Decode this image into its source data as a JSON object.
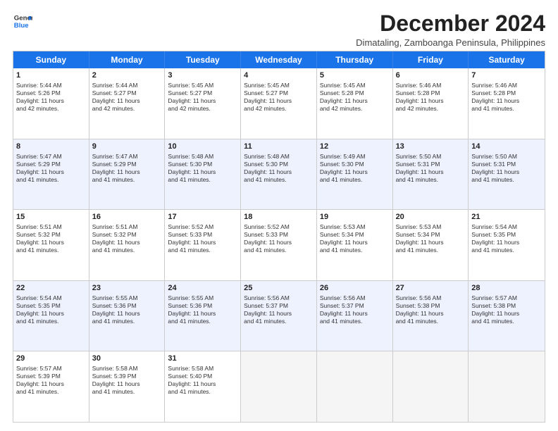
{
  "logo": {
    "line1": "General",
    "line2": "Blue"
  },
  "title": "December 2024",
  "location": "Dimataling, Zamboanga Peninsula, Philippines",
  "header": {
    "days": [
      "Sunday",
      "Monday",
      "Tuesday",
      "Wednesday",
      "Thursday",
      "Friday",
      "Saturday"
    ]
  },
  "rows": [
    [
      {
        "day": "1",
        "sunrise": "Sunrise: 5:44 AM",
        "sunset": "Sunset: 5:26 PM",
        "daylight": "Daylight: 11 hours",
        "minutes": "and 42 minutes."
      },
      {
        "day": "2",
        "sunrise": "Sunrise: 5:44 AM",
        "sunset": "Sunset: 5:27 PM",
        "daylight": "Daylight: 11 hours",
        "minutes": "and 42 minutes."
      },
      {
        "day": "3",
        "sunrise": "Sunrise: 5:45 AM",
        "sunset": "Sunset: 5:27 PM",
        "daylight": "Daylight: 11 hours",
        "minutes": "and 42 minutes."
      },
      {
        "day": "4",
        "sunrise": "Sunrise: 5:45 AM",
        "sunset": "Sunset: 5:27 PM",
        "daylight": "Daylight: 11 hours",
        "minutes": "and 42 minutes."
      },
      {
        "day": "5",
        "sunrise": "Sunrise: 5:45 AM",
        "sunset": "Sunset: 5:28 PM",
        "daylight": "Daylight: 11 hours",
        "minutes": "and 42 minutes."
      },
      {
        "day": "6",
        "sunrise": "Sunrise: 5:46 AM",
        "sunset": "Sunset: 5:28 PM",
        "daylight": "Daylight: 11 hours",
        "minutes": "and 42 minutes."
      },
      {
        "day": "7",
        "sunrise": "Sunrise: 5:46 AM",
        "sunset": "Sunset: 5:28 PM",
        "daylight": "Daylight: 11 hours",
        "minutes": "and 41 minutes."
      }
    ],
    [
      {
        "day": "8",
        "sunrise": "Sunrise: 5:47 AM",
        "sunset": "Sunset: 5:29 PM",
        "daylight": "Daylight: 11 hours",
        "minutes": "and 41 minutes."
      },
      {
        "day": "9",
        "sunrise": "Sunrise: 5:47 AM",
        "sunset": "Sunset: 5:29 PM",
        "daylight": "Daylight: 11 hours",
        "minutes": "and 41 minutes."
      },
      {
        "day": "10",
        "sunrise": "Sunrise: 5:48 AM",
        "sunset": "Sunset: 5:30 PM",
        "daylight": "Daylight: 11 hours",
        "minutes": "and 41 minutes."
      },
      {
        "day": "11",
        "sunrise": "Sunrise: 5:48 AM",
        "sunset": "Sunset: 5:30 PM",
        "daylight": "Daylight: 11 hours",
        "minutes": "and 41 minutes."
      },
      {
        "day": "12",
        "sunrise": "Sunrise: 5:49 AM",
        "sunset": "Sunset: 5:30 PM",
        "daylight": "Daylight: 11 hours",
        "minutes": "and 41 minutes."
      },
      {
        "day": "13",
        "sunrise": "Sunrise: 5:50 AM",
        "sunset": "Sunset: 5:31 PM",
        "daylight": "Daylight: 11 hours",
        "minutes": "and 41 minutes."
      },
      {
        "day": "14",
        "sunrise": "Sunrise: 5:50 AM",
        "sunset": "Sunset: 5:31 PM",
        "daylight": "Daylight: 11 hours",
        "minutes": "and 41 minutes."
      }
    ],
    [
      {
        "day": "15",
        "sunrise": "Sunrise: 5:51 AM",
        "sunset": "Sunset: 5:32 PM",
        "daylight": "Daylight: 11 hours",
        "minutes": "and 41 minutes."
      },
      {
        "day": "16",
        "sunrise": "Sunrise: 5:51 AM",
        "sunset": "Sunset: 5:32 PM",
        "daylight": "Daylight: 11 hours",
        "minutes": "and 41 minutes."
      },
      {
        "day": "17",
        "sunrise": "Sunrise: 5:52 AM",
        "sunset": "Sunset: 5:33 PM",
        "daylight": "Daylight: 11 hours",
        "minutes": "and 41 minutes."
      },
      {
        "day": "18",
        "sunrise": "Sunrise: 5:52 AM",
        "sunset": "Sunset: 5:33 PM",
        "daylight": "Daylight: 11 hours",
        "minutes": "and 41 minutes."
      },
      {
        "day": "19",
        "sunrise": "Sunrise: 5:53 AM",
        "sunset": "Sunset: 5:34 PM",
        "daylight": "Daylight: 11 hours",
        "minutes": "and 41 minutes."
      },
      {
        "day": "20",
        "sunrise": "Sunrise: 5:53 AM",
        "sunset": "Sunset: 5:34 PM",
        "daylight": "Daylight: 11 hours",
        "minutes": "and 41 minutes."
      },
      {
        "day": "21",
        "sunrise": "Sunrise: 5:54 AM",
        "sunset": "Sunset: 5:35 PM",
        "daylight": "Daylight: 11 hours",
        "minutes": "and 41 minutes."
      }
    ],
    [
      {
        "day": "22",
        "sunrise": "Sunrise: 5:54 AM",
        "sunset": "Sunset: 5:35 PM",
        "daylight": "Daylight: 11 hours",
        "minutes": "and 41 minutes."
      },
      {
        "day": "23",
        "sunrise": "Sunrise: 5:55 AM",
        "sunset": "Sunset: 5:36 PM",
        "daylight": "Daylight: 11 hours",
        "minutes": "and 41 minutes."
      },
      {
        "day": "24",
        "sunrise": "Sunrise: 5:55 AM",
        "sunset": "Sunset: 5:36 PM",
        "daylight": "Daylight: 11 hours",
        "minutes": "and 41 minutes."
      },
      {
        "day": "25",
        "sunrise": "Sunrise: 5:56 AM",
        "sunset": "Sunset: 5:37 PM",
        "daylight": "Daylight: 11 hours",
        "minutes": "and 41 minutes."
      },
      {
        "day": "26",
        "sunrise": "Sunrise: 5:56 AM",
        "sunset": "Sunset: 5:37 PM",
        "daylight": "Daylight: 11 hours",
        "minutes": "and 41 minutes."
      },
      {
        "day": "27",
        "sunrise": "Sunrise: 5:56 AM",
        "sunset": "Sunset: 5:38 PM",
        "daylight": "Daylight: 11 hours",
        "minutes": "and 41 minutes."
      },
      {
        "day": "28",
        "sunrise": "Sunrise: 5:57 AM",
        "sunset": "Sunset: 5:38 PM",
        "daylight": "Daylight: 11 hours",
        "minutes": "and 41 minutes."
      }
    ],
    [
      {
        "day": "29",
        "sunrise": "Sunrise: 5:57 AM",
        "sunset": "Sunset: 5:39 PM",
        "daylight": "Daylight: 11 hours",
        "minutes": "and 41 minutes."
      },
      {
        "day": "30",
        "sunrise": "Sunrise: 5:58 AM",
        "sunset": "Sunset: 5:39 PM",
        "daylight": "Daylight: 11 hours",
        "minutes": "and 41 minutes."
      },
      {
        "day": "31",
        "sunrise": "Sunrise: 5:58 AM",
        "sunset": "Sunset: 5:40 PM",
        "daylight": "Daylight: 11 hours",
        "minutes": "and 41 minutes."
      },
      null,
      null,
      null,
      null
    ]
  ]
}
